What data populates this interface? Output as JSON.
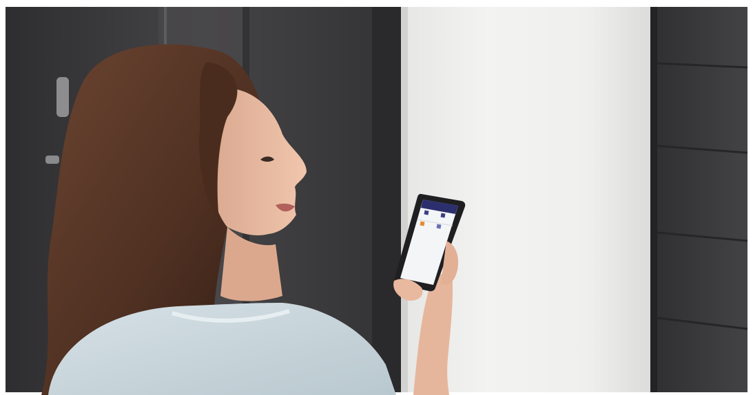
{
  "photo": {
    "subject": "woman-holding-smartphone-at-door",
    "colors": {
      "background": "#ffffff",
      "left_door": "#3f3e40",
      "left_door_shadow": "#2b2a2c",
      "door_frame": "#5a595b",
      "wall_light": "#f1f1f0",
      "wall_shade": "#e2e2e1",
      "right_door": "#3c3b3d",
      "right_door_grooves": "#2a292b",
      "hair": "#5a3a2a",
      "hair_dark": "#3a2418",
      "skin": "#e8b9a0",
      "skin_shadow": "#d49d84",
      "top": "#c9d6dc",
      "phone_body": "#1f1f22",
      "phone_screen": "#f4f5f7",
      "app_header": "#2b2f6e"
    }
  }
}
